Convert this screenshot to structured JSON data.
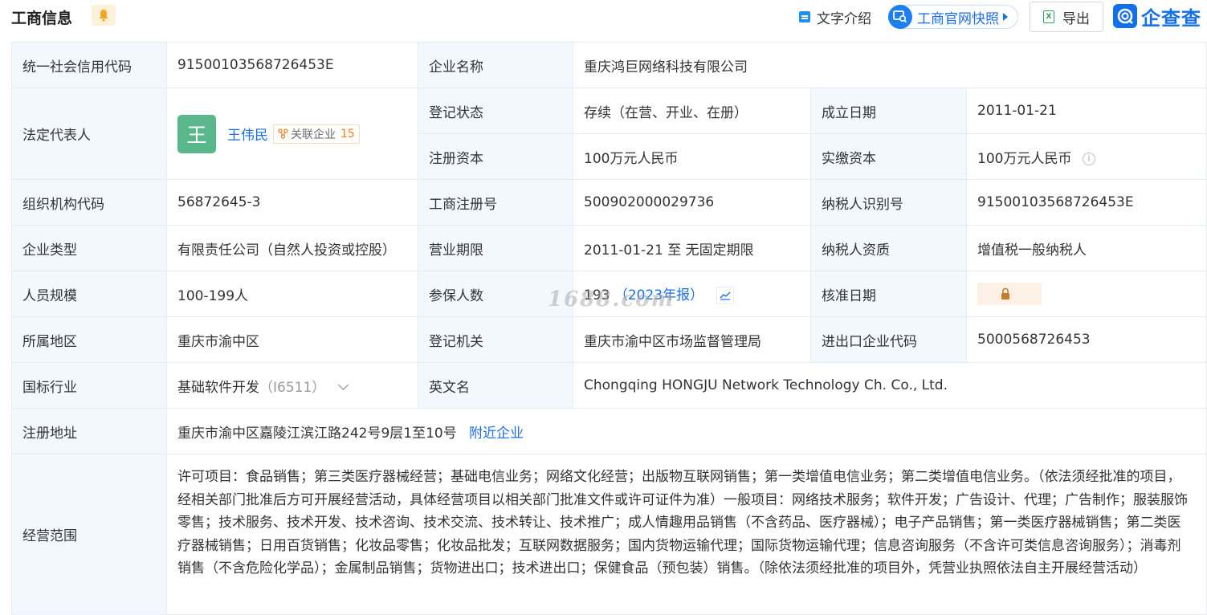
{
  "header": {
    "title": "工商信息",
    "intro_label": "文字介绍",
    "snapshot_label": "工商官网快照",
    "export_label": "导出",
    "logo_text": "企查查"
  },
  "table": {
    "credit_code_label": "统一社会信用代码",
    "credit_code": "91500103568726453E",
    "company_name_label": "企业名称",
    "company_name": "重庆鸿巨网络科技有限公司",
    "legal_rep_label": "法定代表人",
    "legal_rep_avatar": "王",
    "legal_rep_name": "王伟民",
    "related_label": "关联企业",
    "related_count": "15",
    "reg_status_label": "登记状态",
    "reg_status": "存续（在营、开业、在册）",
    "found_date_label": "成立日期",
    "found_date": "2011-01-21",
    "reg_capital_label": "注册资本",
    "reg_capital": "100万元人民币",
    "paid_capital_label": "实缴资本",
    "paid_capital": "100万元人民币",
    "org_code_label": "组织机构代码",
    "org_code": "56872645-3",
    "biz_reg_no_label": "工商注册号",
    "biz_reg_no": "500902000029736",
    "taxpayer_id_label": "纳税人识别号",
    "taxpayer_id": "91500103568726453E",
    "company_type_label": "企业类型",
    "company_type": "有限责任公司（自然人投资或控股）",
    "biz_term_label": "营业期限",
    "biz_term": "2011-01-21 至 无固定期限",
    "taxpayer_qual_label": "纳税人资质",
    "taxpayer_qual": "增值税一般纳税人",
    "staff_size_label": "人员规模",
    "staff_size": "100-199人",
    "insured_label": "参保人数",
    "insured_count": "193",
    "insured_year": "（2023年报）",
    "approval_date_label": "核准日期",
    "region_label": "所属地区",
    "region": "重庆市渝中区",
    "reg_authority_label": "登记机关",
    "reg_authority": "重庆市渝中区市场监督管理局",
    "import_export_label": "进出口企业代码",
    "import_export_code": "5000568726453",
    "industry_label": "国标行业",
    "industry": "基础软件开发",
    "industry_code": "（I6511）",
    "english_name_label": "英文名",
    "english_name": "Chongqing HONGJU Network Technology Ch. Co., Ltd.",
    "address_label": "注册地址",
    "address": "重庆市渝中区嘉陵江滨江路242号9层1至10号",
    "nearby_label": "附近企业",
    "scope_label": "经营范围",
    "scope": "许可项目：食品销售；第三类医疗器械经营；基础电信业务；网络文化经营；出版物互联网销售；第一类增值电信业务；第二类增值电信业务。（依法须经批准的项目，经相关部门批准后方可开展经营活动，具体经营项目以相关部门批准文件或许可证件为准）一般项目：网络技术服务；软件开发；广告设计、代理；广告制作；服装服饰零售；技术服务、技术开发、技术咨询、技术交流、技术转让、技术推广；成人情趣用品销售（不含药品、医疗器械）；电子产品销售；第一类医疗器械销售；第二类医疗器械销售；日用百货销售；化妆品零售；化妆品批发；互联网数据服务；国内货物运输代理；国际货物运输代理；信息咨询服务（不含许可类信息咨询服务）；消毒剂销售（不含危险化学品）；金属制品销售；货物进出口；技术进出口；保健食品（预包装）销售。（除依法须经批准的项目外，凭营业执照依法自主开展经营活动）"
  },
  "watermark": "1688.com",
  "colors": {
    "label_bg": "#f2f8fe",
    "border": "#e5ecf4",
    "link": "#1c6ee6",
    "avatar": "#5ab78b",
    "accent_orange": "#f57d1d"
  }
}
